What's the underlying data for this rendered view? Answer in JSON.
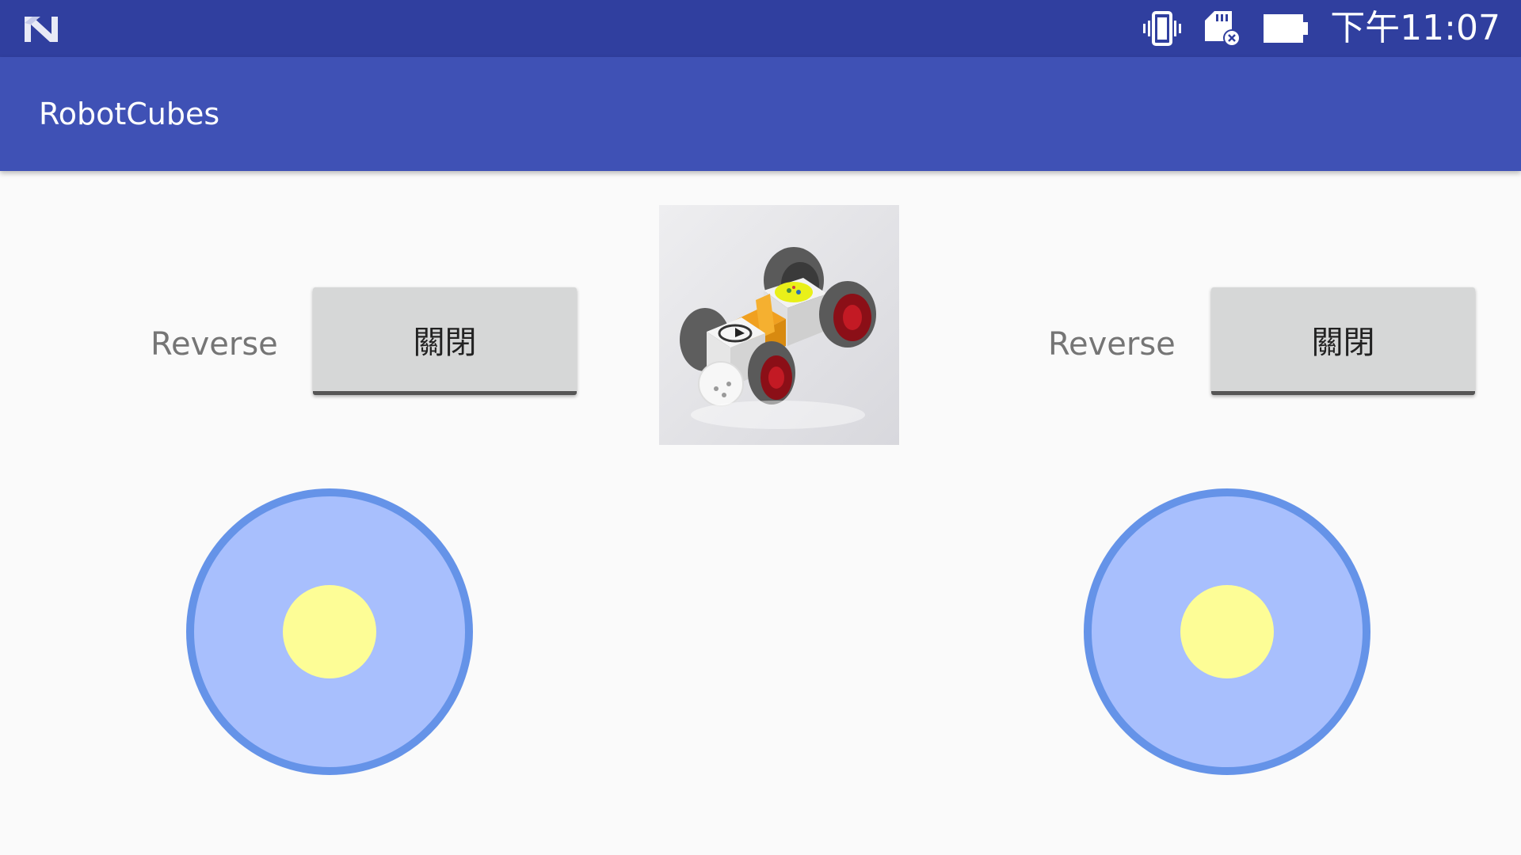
{
  "status_bar": {
    "logo_icon": "android-n-icon",
    "icons": [
      "vibrate-icon",
      "sd-card-error-icon",
      "battery-full-icon"
    ],
    "time": "下午11:07",
    "background": "#303f9f"
  },
  "app_bar": {
    "title": "RobotCubes",
    "background": "#3f51b5"
  },
  "controls": {
    "left": {
      "reverse_label": "Reverse",
      "toggle_label": "關閉"
    },
    "right": {
      "reverse_label": "Reverse",
      "toggle_label": "關閉"
    }
  },
  "image": {
    "alt_icon": "robot-car-image"
  },
  "joysticks": {
    "base_color": "#a8bffd",
    "ring_color": "#6593e8",
    "knob_color": "#fdfd96"
  }
}
